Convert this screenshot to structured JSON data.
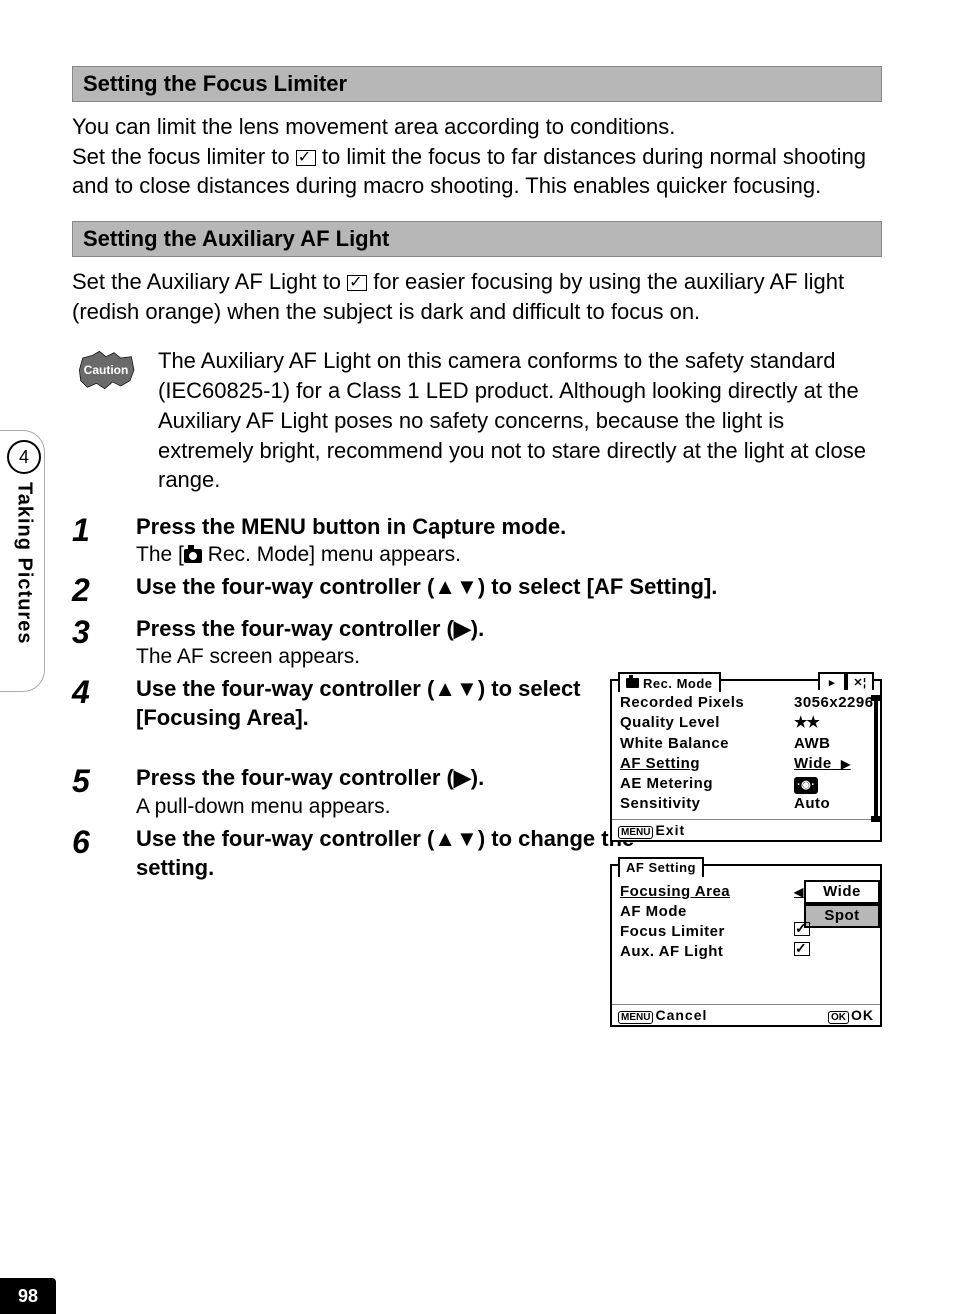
{
  "page_number": "98",
  "side": {
    "chapter": "4",
    "label": "Taking Pictures"
  },
  "section1": {
    "title": "Setting the Focus Limiter",
    "body": "You can limit the lens movement area according to conditions.\nSet the focus limiter to ☑ to limit the focus to far distances during normal shooting and to close distances during macro shooting. This enables quicker focusing."
  },
  "section2": {
    "title": "Setting the Auxiliary AF Light",
    "body": "Set the Auxiliary AF Light to ☑ for easier focusing by using the auxiliary AF light (redish orange) when the subject is dark and difficult to focus on."
  },
  "caution": {
    "label": "Caution",
    "body": "The Auxiliary AF Light on this camera conforms to the safety standard (IEC60825-1) for a Class 1 LED product. Although looking directly at the Auxiliary AF Light poses no safety concerns, because the light is extremely bright, recommend you not to stare directly at the light at close range."
  },
  "steps": [
    {
      "num": "1",
      "title_pre": "Press the ",
      "title_key": "MENU",
      "title_post": " button in Capture mode.",
      "sub_pre": "The [",
      "sub_post": " Rec. Mode] menu appears."
    },
    {
      "num": "2",
      "title": "Use the four-way controller (▲▼) to select [AF Setting]."
    },
    {
      "num": "3",
      "title": "Press the four-way controller (▶).",
      "sub": "The AF screen appears."
    },
    {
      "num": "4",
      "title": "Use the four-way controller (▲▼) to select [Focusing Area]."
    },
    {
      "num": "5",
      "title": "Press the four-way controller (▶).",
      "sub": "A pull-down menu appears."
    },
    {
      "num": "6",
      "title": "Use the four-way controller (▲▼) to change the setting."
    }
  ],
  "lcd1": {
    "tab": "Rec. Mode",
    "rows": [
      {
        "label": "Recorded Pixels",
        "value": "3056x2296"
      },
      {
        "label": "Quality Level",
        "value": "★★"
      },
      {
        "label": "White Balance",
        "value": "AWB"
      },
      {
        "label": "AF Setting",
        "value": "Wide",
        "selected": true,
        "arrow": true
      },
      {
        "label": "AE Metering",
        "value": "eye"
      },
      {
        "label": "Sensitivity",
        "value": "Auto"
      }
    ],
    "foot_left": "Exit"
  },
  "lcd2": {
    "tab": "AF Setting",
    "rows": [
      {
        "label": "Focusing Area",
        "selected": true
      },
      {
        "label": "AF Mode"
      },
      {
        "label": "Focus Limiter",
        "check": true
      },
      {
        "label": "Aux. AF Light",
        "check": true
      }
    ],
    "dropdown": [
      "Wide",
      "Spot"
    ],
    "foot_left": "Cancel",
    "foot_right": "OK"
  }
}
